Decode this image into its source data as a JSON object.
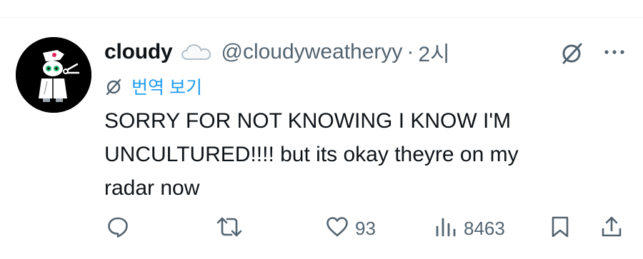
{
  "post": {
    "author": {
      "display_name": "cloudy",
      "handle": "@cloudyweatheryy",
      "badge_icon": "cloud-icon"
    },
    "separator": "·",
    "time": "2시",
    "translate_label": "번역 보기",
    "text": "SORRY FOR NOT KNOWING I KNOW I'M\nUNCULTURED!!!! but its okay theyre on my\nradar now",
    "actions": {
      "reply": {
        "icon": "reply-icon"
      },
      "repost": {
        "icon": "repost-icon"
      },
      "like": {
        "icon": "heart-icon",
        "count": "93"
      },
      "views": {
        "icon": "views-icon",
        "count": "8463"
      },
      "bookmark": {
        "icon": "bookmark-icon"
      },
      "share": {
        "icon": "share-icon"
      }
    }
  },
  "colors": {
    "text": "#0f1419",
    "secondary": "#536471",
    "link": "#1d9bf0",
    "divider": "#eff3f4"
  }
}
